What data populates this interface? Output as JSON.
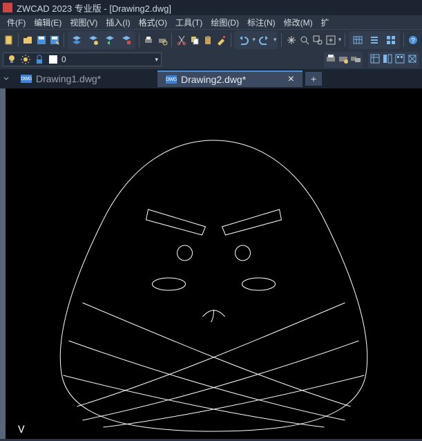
{
  "title": "ZWCAD 2023 专业版 - [Drawing2.dwg]",
  "menu": {
    "file": "件(F)",
    "edit": "编辑(E)",
    "view": "视图(V)",
    "insert": "插入(I)",
    "format": "格式(O)",
    "tools": "工具(T)",
    "draw": "绘图(D)",
    "dim": "标注(N)",
    "modify": "修改(M)",
    "ext": "扩"
  },
  "layer": {
    "current": "0"
  },
  "tabs": {
    "t1": "Drawing1.dwg*",
    "t2": "Drawing2.dwg*"
  },
  "icons": {
    "new": "new",
    "open": "open",
    "save": "save",
    "saveas": "saveas",
    "layers": "layers",
    "layeroff": "layeroff",
    "layerprev": "layerprev",
    "print": "print",
    "cut": "cut",
    "copy": "copy",
    "paste": "paste",
    "brush": "brush",
    "undo": "undo",
    "redo": "redo",
    "pan": "pan",
    "zoomin": "zoomin",
    "zoomext": "zoomext",
    "zoomwin": "zoomwin",
    "table": "table",
    "list": "list",
    "grid": "grid",
    "help": "help",
    "plus": "+",
    "close": "×",
    "dropdown": "▾",
    "bulb": "bulb",
    "sun": "sun",
    "lock": "lock",
    "square": "square",
    "printset": "printset",
    "printers": "printers",
    "props": "props",
    "blocks": "blocks",
    "hatch": "hatch",
    "array": "array"
  },
  "ucs": "V"
}
